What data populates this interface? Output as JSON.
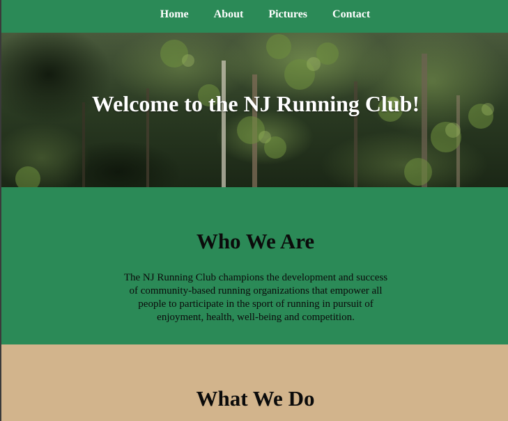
{
  "nav": {
    "items": [
      {
        "label": "Home"
      },
      {
        "label": "About"
      },
      {
        "label": "Pictures"
      },
      {
        "label": "Contact"
      }
    ]
  },
  "hero": {
    "title": "Welcome to the NJ Running Club!"
  },
  "who_we_are": {
    "title": "Who We Are",
    "text": "The NJ Running Club champions the development and success of community-based running organizations that empower all people to participate in the sport of running in pursuit of enjoyment, health, well-being and competition."
  },
  "what_we_do": {
    "title": "What We Do"
  },
  "colors": {
    "green": "#2b8a57",
    "tan": "#d2b48c",
    "text_dark": "#0b0b0b",
    "nav_text": "#ffffff"
  }
}
